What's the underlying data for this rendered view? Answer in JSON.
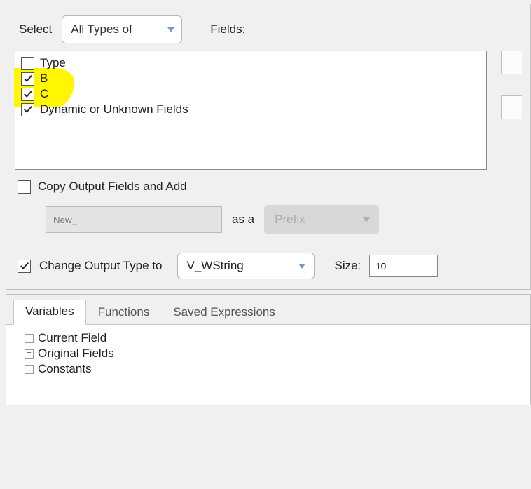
{
  "top": {
    "select_label": "Select",
    "select_dropdown": "All Types of",
    "fields_label": "Fields:"
  },
  "fields": [
    {
      "label": "Type",
      "checked": false
    },
    {
      "label": "B",
      "checked": true
    },
    {
      "label": "C",
      "checked": true
    },
    {
      "label": "Dynamic or Unknown Fields",
      "checked": true
    }
  ],
  "copy": {
    "checkbox_label": "Copy Output Fields and Add",
    "checked": false,
    "new_value": "New_",
    "as_a_label": "as a",
    "prefix_label": "Prefix"
  },
  "change_type": {
    "checked": true,
    "label": "Change Output Type to",
    "type_value": "V_WString",
    "size_label": "Size:",
    "size_value": "10"
  },
  "tabs": {
    "items": [
      "Variables",
      "Functions",
      "Saved Expressions"
    ],
    "active": 0
  },
  "tree": [
    "Current Field",
    "Original Fields",
    "Constants"
  ]
}
